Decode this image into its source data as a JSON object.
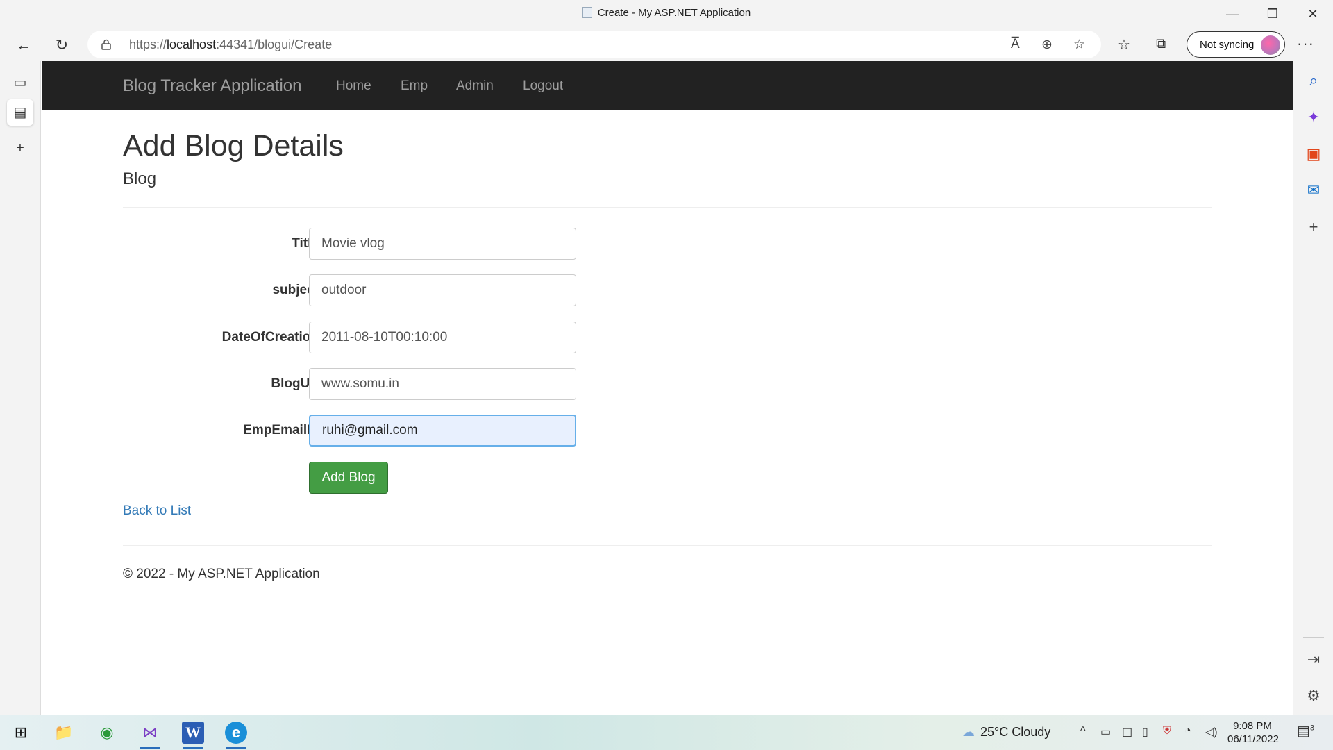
{
  "window": {
    "title": "Create - My ASP.NET Application",
    "minimize": "—",
    "restore": "❐",
    "close": "✕"
  },
  "toolbar": {
    "back": "←",
    "refresh": "↻",
    "url_prefix": "https://",
    "url_host": "localhost",
    "url_rest": ":44341/blogui/Create",
    "read_aloud": "A̅",
    "zoom": "⊕",
    "add_favorite": "☆",
    "favorites": "☆",
    "collections": "⧉",
    "sync_label": "Not syncing",
    "more": "···"
  },
  "leftbar": {
    "tab_actions": "▭",
    "active_tab": "▤",
    "new_tab": "+"
  },
  "rightbar": {
    "search": "⌕",
    "copilot": "✦",
    "office": "▣",
    "outlook": "✉",
    "add": "+",
    "hide": "⇥",
    "settings": "⚙"
  },
  "navbar": {
    "brand": "Blog Tracker Application",
    "links": [
      "Home",
      "Emp",
      "Admin",
      "Logout"
    ]
  },
  "page": {
    "title": "Add Blog Details",
    "subtitle": "Blog",
    "fields": [
      {
        "label": "Title",
        "value": "Movie vlog"
      },
      {
        "label": "subject",
        "value": "outdoor"
      },
      {
        "label": "DateOfCreation",
        "value": "2011-08-10T00:10:00"
      },
      {
        "label": "BlogUrl",
        "value": "www.somu.in"
      },
      {
        "label": "EmpEmailId",
        "value": "ruhi@gmail.com"
      }
    ],
    "submit": "Add Blog",
    "back_link": "Back to List",
    "footer": "© 2022 - My ASP.NET Application"
  },
  "taskbar": {
    "start": "⊞",
    "explorer": "📁",
    "chrome": "◉",
    "visualstudio": "⋈",
    "word": "W",
    "edge": "e",
    "weather": "25°C  Cloudy",
    "time": "9:08 PM",
    "date": "06/11/2022",
    "notifications": "3"
  },
  "colors": {
    "navbar_bg": "#222222",
    "link": "#337ab7",
    "button_green": "#449d44"
  }
}
